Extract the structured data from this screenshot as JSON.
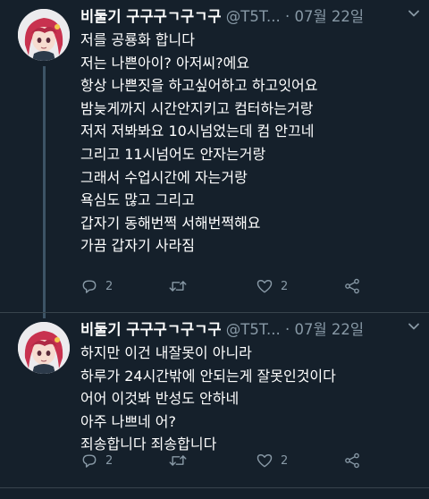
{
  "tweets": [
    {
      "name": "비둘기 구구구ㄱ구ㄱ구",
      "handle": "@T5T...",
      "dot": "·",
      "date": "07월 22일",
      "lines": [
        "저를 공룡화 합니다",
        "저는 나쁜아이? 아저씨?에요",
        "항상 나쁜짓을 하고싶어하고 하고잇어요",
        "밤늦게까지 시간안지키고 컴터하는거랑",
        "저저 저봐봐요 10시넘었는데 컴 안끄네",
        "그리고 11시넘어도 안자는거랑",
        "그래서 수업시간에 자는거랑",
        "욕심도 많고 그리고",
        "갑자기 동해번쩍 서해번쩍해요",
        "가끔 갑자기 사라짐"
      ],
      "reply_count": "2",
      "retweet_count": "",
      "like_count": "2"
    },
    {
      "name": "비둘기 구구구ㄱ구ㄱ구",
      "handle": "@T5T...",
      "dot": "·",
      "date": "07월 22일",
      "lines": [
        "하지만 이건 내잘못이 아니라",
        "하루가 24시간밖에 안되는게 잘못인것이다",
        "어어 이것봐 반성도 안하네",
        "아주 나쁘네 어?",
        "죄송합니다 죄송합니다"
      ],
      "reply_count": "2",
      "retweet_count": "",
      "like_count": "2"
    }
  ],
  "icons": {
    "reply": "reply-icon",
    "retweet": "retweet-icon",
    "like": "like-icon",
    "share": "share-icon",
    "caret": "chevron-down-icon"
  },
  "colors": {
    "background": "#15202b",
    "secondary_text": "#8899a6",
    "divider": "#38444d",
    "avatar_hair": "#c8324f"
  }
}
